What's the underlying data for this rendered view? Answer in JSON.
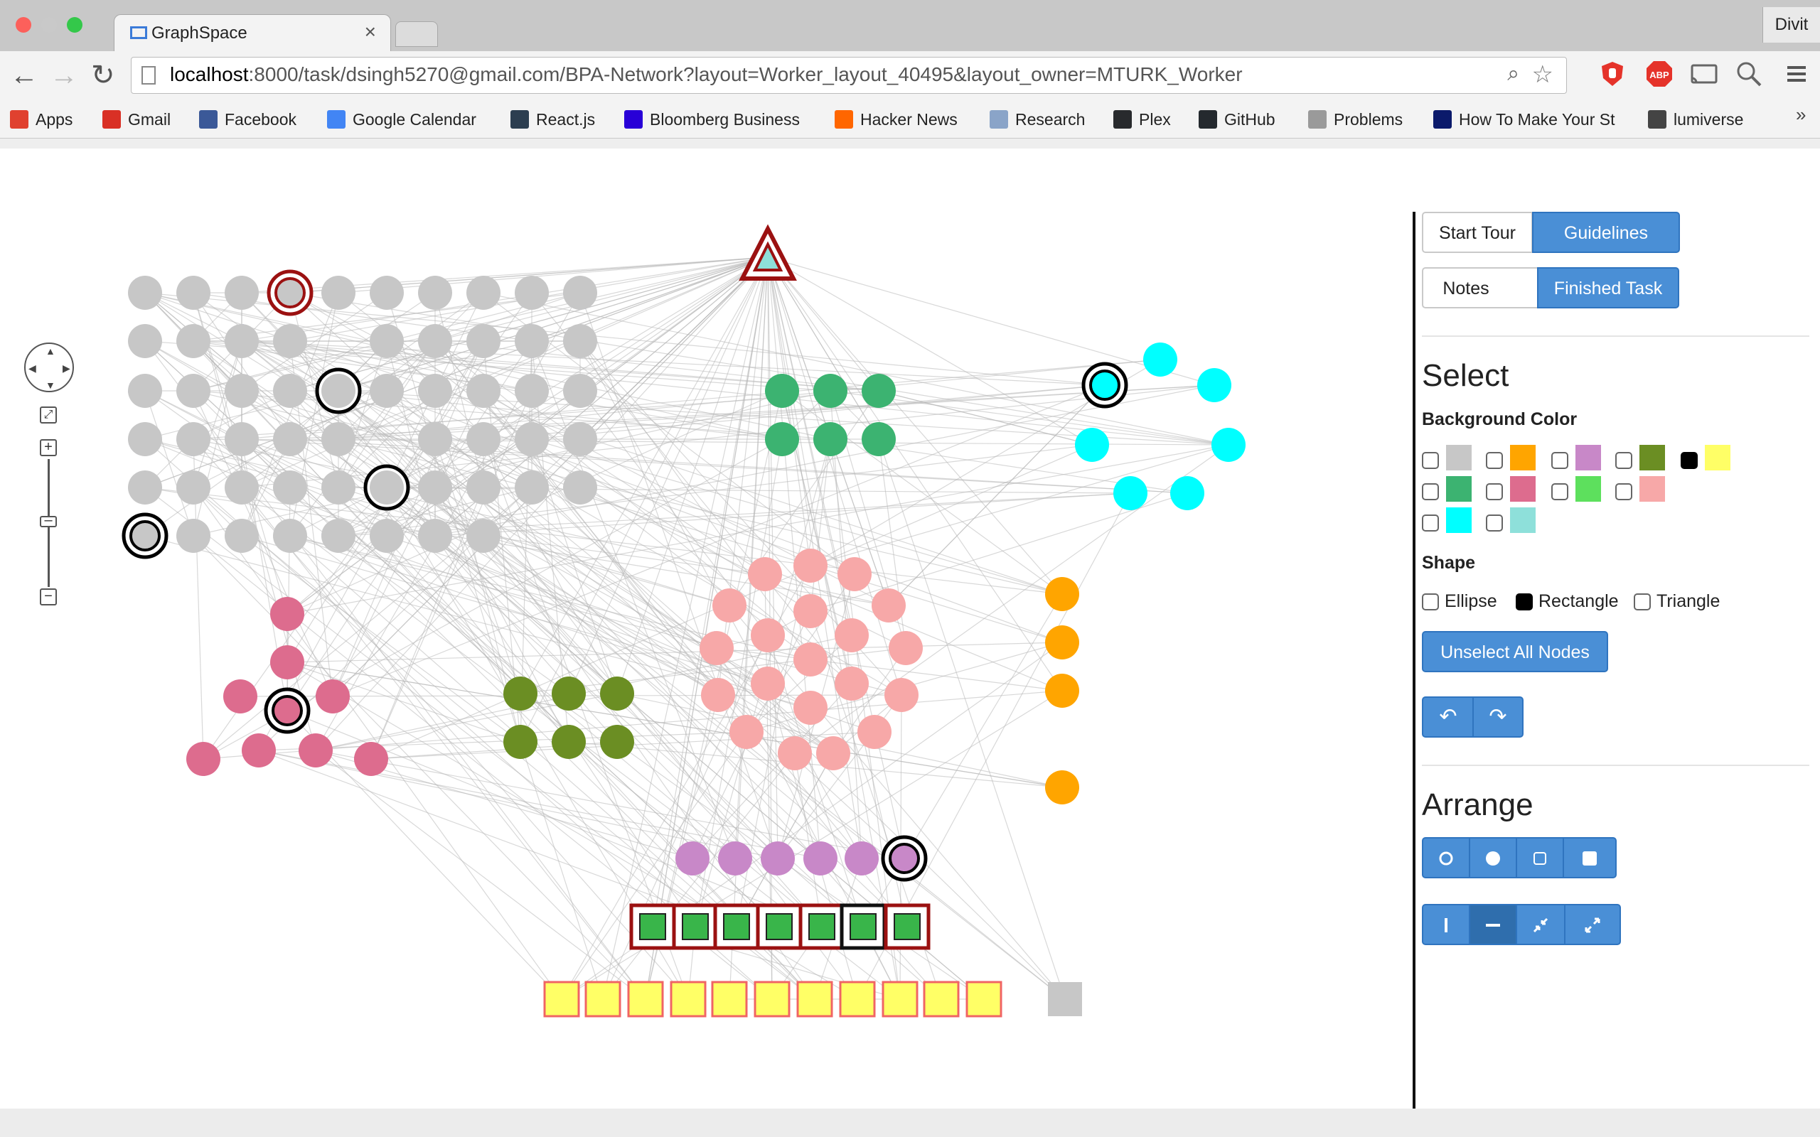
{
  "browser": {
    "tab_title": "GraphSpace",
    "profile_name": "Divit",
    "url_host": "localhost",
    "url_rest": ":8000/task/dsingh5270@gmail.com/BPA-Network?layout=Worker_layout_40495&layout_owner=MTURK_Worker",
    "bookmarks": [
      {
        "label": "Apps",
        "icon": "apps-grid-icon",
        "color": "#e0412f"
      },
      {
        "label": "Gmail",
        "icon": "gmail-icon",
        "color": "#d93025"
      },
      {
        "label": "Facebook",
        "icon": "facebook-icon",
        "color": "#3b5998"
      },
      {
        "label": "Google Calendar",
        "icon": "google-calendar-icon",
        "color": "#4285f4"
      },
      {
        "label": "React.js",
        "icon": "react-icon",
        "color": "#2c3e50"
      },
      {
        "label": "Bloomberg Business",
        "icon": "bloomberg-icon",
        "color": "#2800d7"
      },
      {
        "label": "Hacker News",
        "icon": "hacker-news-icon",
        "color": "#ff6600"
      },
      {
        "label": "Research",
        "icon": "folder-icon",
        "color": "#8aa4c8"
      },
      {
        "label": "Plex",
        "icon": "plex-icon",
        "color": "#282a2d"
      },
      {
        "label": "GitHub",
        "icon": "github-icon",
        "color": "#24292e"
      },
      {
        "label": "Problems",
        "icon": "page-icon",
        "color": "#9a9a9a"
      },
      {
        "label": "How To Make Your St",
        "icon": "f-icon",
        "color": "#0b1a6b"
      },
      {
        "label": "lumiverse",
        "icon": "wc-icon",
        "color": "#444444"
      }
    ],
    "overflow_glyph": "»"
  },
  "panel": {
    "start_tour": "Start Tour",
    "guidelines": "Guidelines",
    "notes": "Notes",
    "finished_task": "Finished Task",
    "select_heading": "Select",
    "background_color_label": "Background Color",
    "color_swatches": [
      {
        "color": "#c7c7c7",
        "checked": false
      },
      {
        "color": "#ffa500",
        "checked": false
      },
      {
        "color": "#c888c8",
        "checked": false
      },
      {
        "color": "#6b8e23",
        "checked": false
      },
      {
        "color": "#ffff66",
        "checked": true
      },
      {
        "color": "#3cb371",
        "checked": false
      },
      {
        "color": "#dd6c8e",
        "checked": false
      },
      {
        "color": "#5de05d",
        "checked": false
      },
      {
        "color": "#f7a8a8",
        "checked": false
      },
      {
        "color": "#00ffff",
        "checked": false
      },
      {
        "color": "#8ee0da",
        "checked": false
      }
    ],
    "shape_label": "Shape",
    "shapes": [
      {
        "label": "Ellipse",
        "checked": false
      },
      {
        "label": "Rectangle",
        "checked": true
      },
      {
        "label": "Triangle",
        "checked": false
      }
    ],
    "unselect_all": "Unselect All Nodes",
    "undo_icon": "undo-icon",
    "redo_icon": "redo-icon",
    "arrange_heading": "Arrange",
    "arrange_icons": [
      "circle-outline-icon",
      "circle-filled-icon",
      "square-outline-icon",
      "square-filled-icon"
    ],
    "layout_icons": [
      "vertical-line-icon",
      "horizontal-line-icon",
      "compress-icon",
      "expand-icon"
    ]
  },
  "graph": {
    "colors": {
      "gray": "#c7c7c7",
      "green": "#3cb371",
      "cyan": "#00ffff",
      "pink": "#f7a8a8",
      "orange": "#ffa500",
      "rose": "#dd6c8e",
      "olive": "#6b8e23",
      "purple": "#c888c8",
      "yellow": "#ffff66",
      "lime": "#39b54a",
      "triangle": "#8ee0da",
      "edge": "#b8b8b8",
      "arrow": "#0a14e8",
      "highlight_red": "#9b1111"
    }
  }
}
